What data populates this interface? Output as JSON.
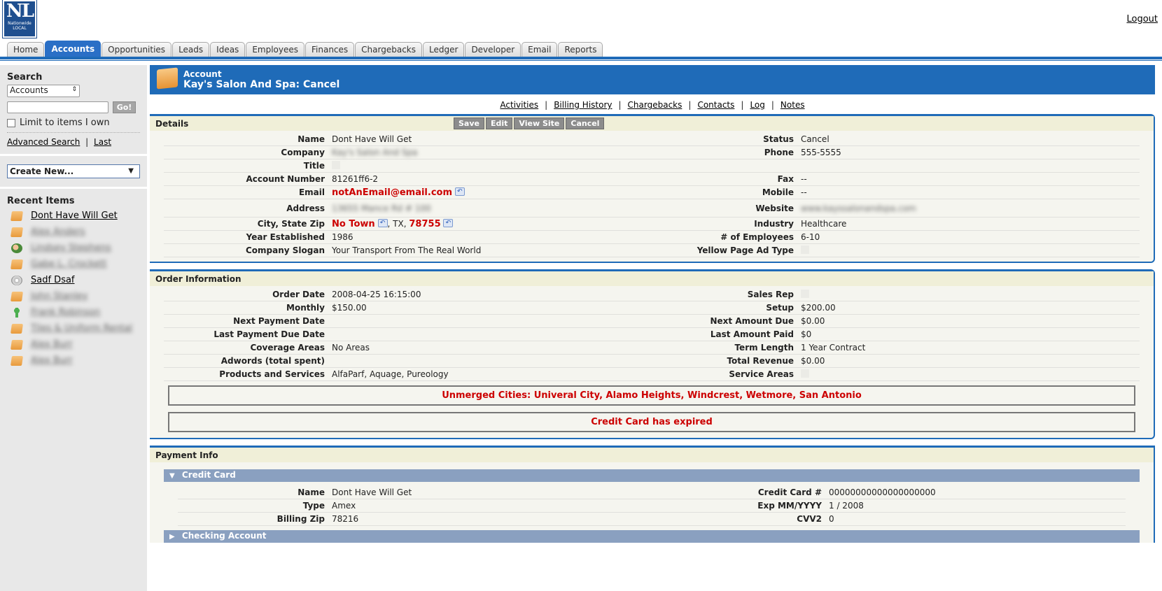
{
  "header": {
    "logo_big": "NL",
    "logo_line1": "Nationwide",
    "logo_line2": "LOCAL",
    "logout": "Logout"
  },
  "tabs": [
    {
      "label": "Home"
    },
    {
      "label": "Accounts",
      "active": true
    },
    {
      "label": "Opportunities"
    },
    {
      "label": "Leads"
    },
    {
      "label": "Ideas"
    },
    {
      "label": "Employees"
    },
    {
      "label": "Finances"
    },
    {
      "label": "Chargebacks"
    },
    {
      "label": "Ledger"
    },
    {
      "label": "Developer"
    },
    {
      "label": "Email"
    },
    {
      "label": "Reports"
    }
  ],
  "sidebar": {
    "search_title": "Search",
    "search_scope": "Accounts",
    "go": "Go!",
    "limit_label": "Limit to items I own",
    "advanced_search": "Advanced Search",
    "separator": "|",
    "last": "Last",
    "create_new": "Create New...",
    "recent_title": "Recent Items",
    "recent": [
      {
        "label": "Dont Have Will Get",
        "icon": "folder-icon",
        "blurred": false
      },
      {
        "label": "Alex Anders",
        "icon": "folder-icon",
        "blurred": true
      },
      {
        "label": "Lindsey Stephens",
        "icon": "contact-icon",
        "blurred": true
      },
      {
        "label": "Gabe L. Crockett",
        "icon": "folder-icon",
        "blurred": true
      },
      {
        "label": "Sadf Dsaf",
        "icon": "disc-icon",
        "blurred": false
      },
      {
        "label": "John Stanley",
        "icon": "folder-icon",
        "blurred": true
      },
      {
        "label": "Frank Robinson",
        "icon": "lead-icon",
        "blurred": true
      },
      {
        "label": "Tiles & Uniform Rental",
        "icon": "folder-icon",
        "blurred": true
      },
      {
        "label": "Alex Burr",
        "icon": "folder-icon",
        "blurred": true
      },
      {
        "label": "Alex Burr",
        "icon": "folder-icon",
        "blurred": true
      }
    ]
  },
  "account": {
    "label": "Account",
    "title": "Kay's Salon And Spa: Cancel"
  },
  "subnav": {
    "links": [
      "Activities",
      "Billing History",
      "Chargebacks",
      "Contacts",
      "Log",
      "Notes"
    ],
    "sep": "|"
  },
  "details": {
    "title": "Details",
    "buttons": [
      "Save",
      "Edit",
      "View Site",
      "Cancel"
    ],
    "left": {
      "name_label": "Name",
      "name": "Dont Have Will Get",
      "company_label": "Company",
      "company": "Kay's Salon And Spa",
      "title_label": "Title",
      "account_number_label": "Account Number",
      "account_number": "81261ff6-2",
      "email_label": "Email",
      "email": "notAnEmail@email.com",
      "address_label": "Address",
      "address": "13655 Mance Rd # 100",
      "city_label": "City, State Zip",
      "city": "No Town",
      "comma1": ",",
      "state": "TX",
      "comma2": ",",
      "zip": "78755",
      "year_label": "Year Established",
      "year": "1986",
      "slogan_label": "Company Slogan",
      "slogan": "Your Transport From The Real World"
    },
    "right": {
      "status_label": "Status",
      "status": "Cancel",
      "phone_label": "Phone",
      "phone": "555-5555",
      "fax_label": "Fax",
      "fax": "--",
      "mobile_label": "Mobile",
      "mobile": "--",
      "website_label": "Website",
      "website": "www.kayssalonandspa.com",
      "industry_label": "Industry",
      "industry": "Healthcare",
      "employees_label": "# of Employees",
      "employees": "6-10",
      "ypad_label": "Yellow Page Ad Type"
    }
  },
  "order": {
    "title": "Order Information",
    "rows": [
      {
        "l": "Order Date",
        "v": "2008-04-25 16:15:00",
        "l2": "Sales Rep",
        "v2": ""
      },
      {
        "l": "Monthly",
        "v": "$150.00",
        "l2": "Setup",
        "v2": "$200.00"
      },
      {
        "l": "Next Payment Date",
        "v": "",
        "l2": "Next Amount Due",
        "v2": "$0.00"
      },
      {
        "l": "Last Payment Due Date",
        "v": "",
        "l2": "Last Amount Paid",
        "v2": "$0"
      },
      {
        "l": "Coverage Areas",
        "v": "No Areas",
        "l2": "Term Length",
        "v2": "1 Year Contract"
      },
      {
        "l": "Adwords (total spent)",
        "v": "",
        "l2": "Total Revenue",
        "v2": "$0.00"
      },
      {
        "l": "Products and Services",
        "v": "AlfaParf, Aquage, Pureology",
        "l2": "Service Areas",
        "v2": ""
      }
    ],
    "alert1": "Unmerged Cities: Univeral City, Alamo Heights, Windcrest, Wetmore, San Antonio",
    "alert2": "Credit Card has expired"
  },
  "payment": {
    "title": "Payment Info",
    "cc_title": "Credit Card",
    "cc_rows": [
      {
        "l": "Name",
        "v": "Dont Have Will Get",
        "l2": "Credit Card #",
        "v2": "00000000000000000000"
      },
      {
        "l": "Type",
        "v": "Amex",
        "l2": "Exp MM/YYYY",
        "v2": "1 / 2008"
      },
      {
        "l": "Billing Zip",
        "v": "78216",
        "l2": "CVV2",
        "v2": "0"
      }
    ],
    "checking_title": "Checking Account"
  },
  "colors": {
    "accent": "#1f6bb8",
    "alert": "#cc0000",
    "section_bar": "#8aa0c0"
  }
}
